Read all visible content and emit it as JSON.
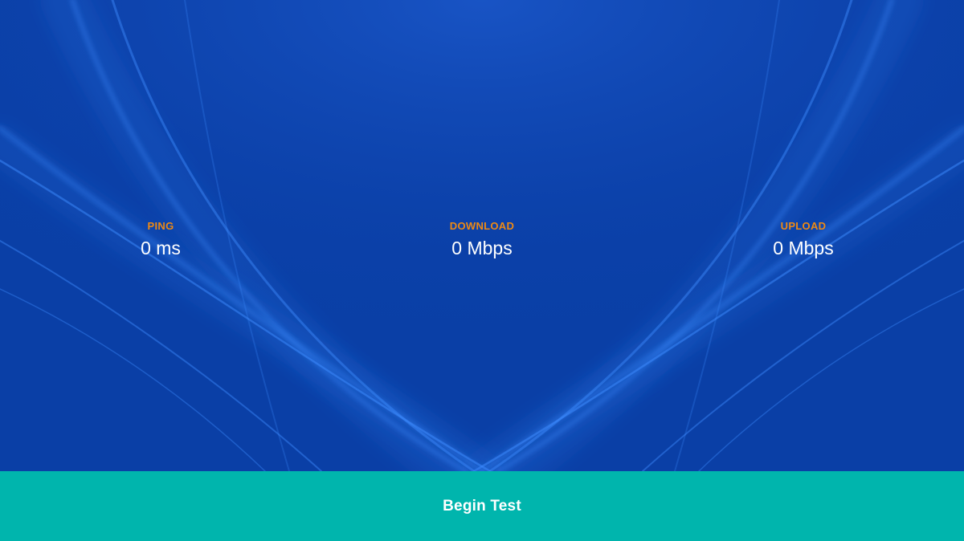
{
  "colors": {
    "background": "#0a3fa6",
    "accent_label": "#ef8a13",
    "button": "#00b5ad",
    "text": "#ffffff"
  },
  "stats": {
    "ping": {
      "label": "PING",
      "value": "0 ms"
    },
    "download": {
      "label": "DOWNLOAD",
      "value": "0 Mbps"
    },
    "upload": {
      "label": "UPLOAD",
      "value": "0 Mbps"
    }
  },
  "begin_button": {
    "label": "Begin Test"
  }
}
